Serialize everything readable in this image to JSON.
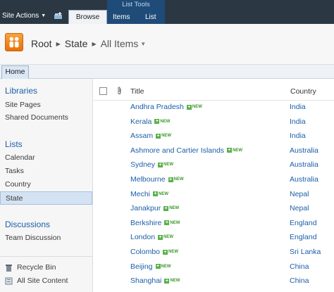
{
  "ribbon": {
    "site_actions": "Site Actions",
    "tab_browse": "Browse",
    "context_group": "List Tools",
    "tab_items": "Items",
    "tab_list": "List"
  },
  "breadcrumb": {
    "root": "Root",
    "state": "State",
    "current": "All Items"
  },
  "topbar": {
    "home": "Home"
  },
  "leftnav": {
    "libraries": "Libraries",
    "libraries_items": [
      "Site Pages",
      "Shared Documents"
    ],
    "lists": "Lists",
    "lists_items": [
      "Calendar",
      "Tasks",
      "Country",
      "State"
    ],
    "discussions": "Discussions",
    "discussions_items": [
      "Team Discussion"
    ],
    "recycle_bin": "Recycle Bin",
    "all_site_content": "All Site Content"
  },
  "list": {
    "col_title": "Title",
    "col_country": "Country",
    "new_label": "NEW",
    "rows": [
      {
        "title": "Andhra Pradesh",
        "country": "India"
      },
      {
        "title": "Kerala",
        "country": "India"
      },
      {
        "title": "Assam",
        "country": "India"
      },
      {
        "title": "Ashmore and Cartier Islands",
        "country": "Australia"
      },
      {
        "title": "Sydney",
        "country": "Australia"
      },
      {
        "title": "Melbourne",
        "country": "Australia"
      },
      {
        "title": "Mechi",
        "country": "Nepal"
      },
      {
        "title": "Janakpur",
        "country": "Nepal"
      },
      {
        "title": "Berkshire",
        "country": "England"
      },
      {
        "title": "London",
        "country": "England"
      },
      {
        "title": "Colombo",
        "country": "Sri Lanka"
      },
      {
        "title": "Beijing",
        "country": "China"
      },
      {
        "title": "Shanghai",
        "country": "China"
      }
    ]
  }
}
